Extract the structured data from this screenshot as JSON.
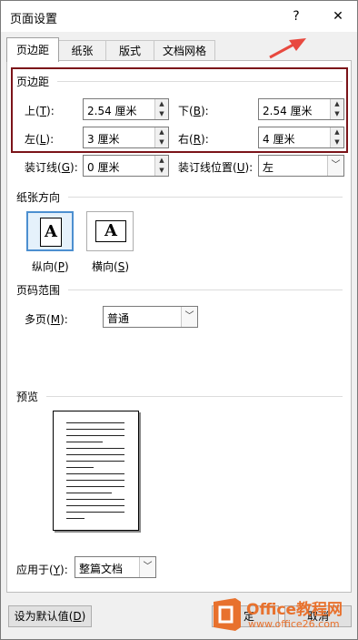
{
  "window": {
    "title": "页面设置",
    "help_glyph": "?",
    "close_glyph": "✕"
  },
  "tabs": [
    {
      "label": "页边距",
      "active": true
    },
    {
      "label": "纸张"
    },
    {
      "label": "版式"
    },
    {
      "label": "文档网格"
    }
  ],
  "margins": {
    "section_title": "页边距",
    "top": {
      "label": "上",
      "key": "T",
      "value": "2.54 厘米"
    },
    "bottom": {
      "label": "下",
      "key": "B",
      "value": "2.54 厘米"
    },
    "left": {
      "label": "左",
      "key": "L",
      "value": "3 厘米"
    },
    "right": {
      "label": "右",
      "key": "R",
      "value": "4 厘米"
    },
    "gutter": {
      "label": "装订线",
      "key": "G",
      "value": "0 厘米"
    },
    "gutter_pos": {
      "label": "装订线位置",
      "key": "U",
      "value": "左"
    }
  },
  "orientation": {
    "section_title": "纸张方向",
    "portrait": {
      "label": "纵向",
      "key": "P",
      "glyph": "A"
    },
    "landscape": {
      "label": "横向",
      "key": "S",
      "glyph": "A"
    }
  },
  "pages": {
    "section_title": "页码范围",
    "multi": {
      "label": "多页",
      "key": "M",
      "value": "普通"
    }
  },
  "preview": {
    "section_title": "预览"
  },
  "apply": {
    "label": "应用于",
    "key": "Y",
    "value": "整篇文档"
  },
  "buttons": {
    "default_label": "设为默认值",
    "default_key": "D",
    "ok_label": "定",
    "cancel_label": "取消"
  },
  "watermark": {
    "brand": "Office教程网",
    "url": "www.office26.com"
  },
  "colors": {
    "highlight": "#7b1419",
    "arrow": "#e8493f",
    "brand": "#e8712d"
  }
}
